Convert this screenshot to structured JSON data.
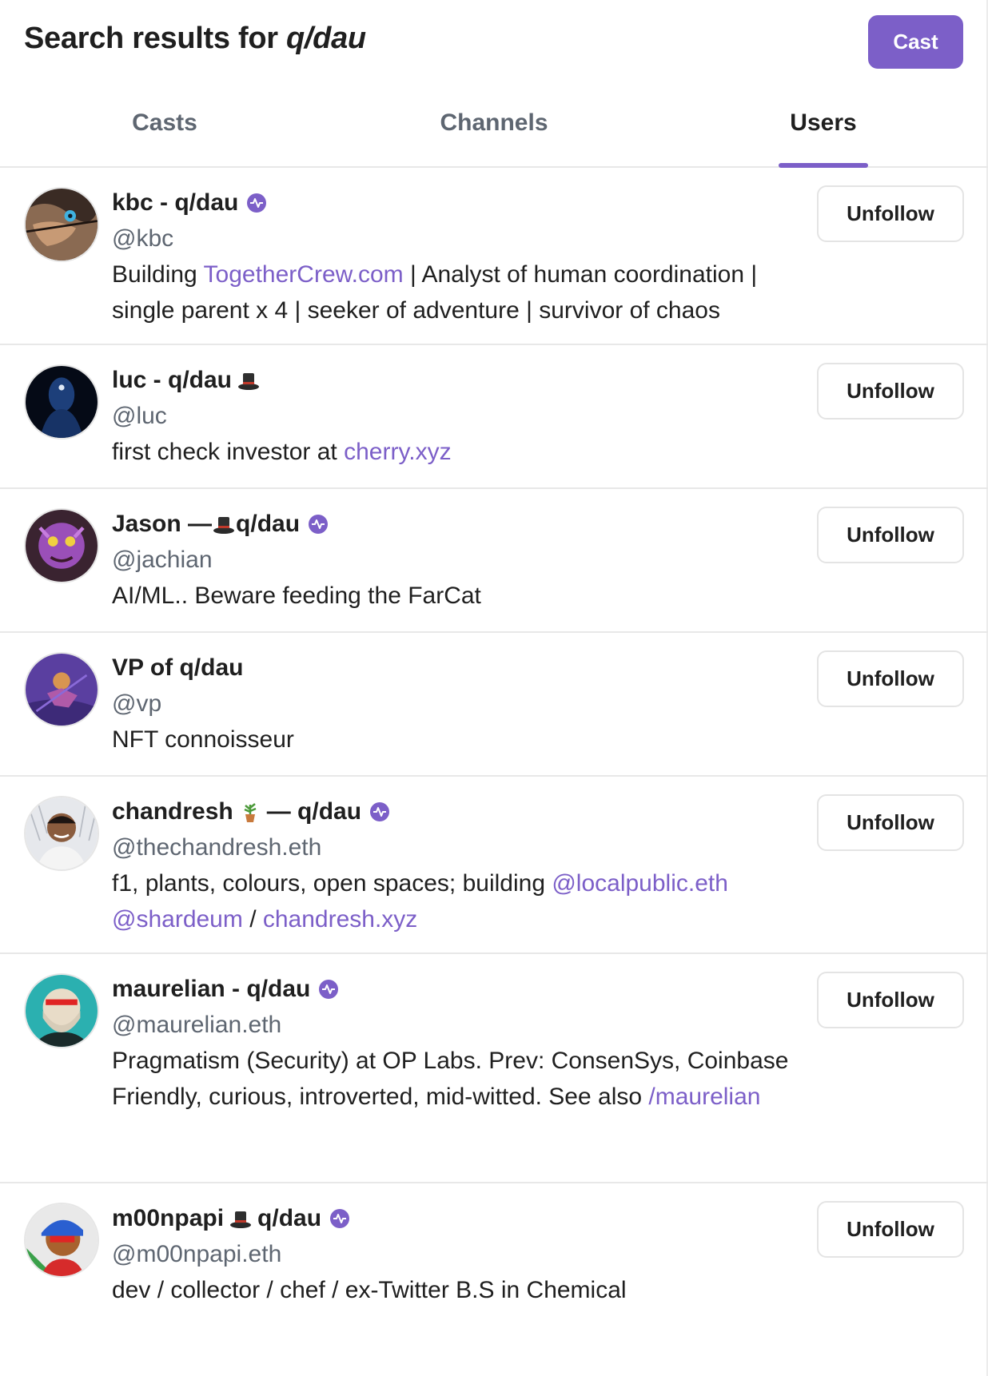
{
  "header": {
    "title_prefix": "Search results for",
    "query": "q/dau",
    "cast_label": "Cast"
  },
  "tabs": [
    {
      "label": "Casts",
      "active": false
    },
    {
      "label": "Channels",
      "active": false
    },
    {
      "label": "Users",
      "active": true
    }
  ],
  "colors": {
    "accent": "#7c5fc8",
    "muted_text": "#5e6671",
    "border": "#e8e8e8"
  },
  "users": [
    {
      "name": "kbc - q/dau",
      "badge": "verified-icon",
      "handle": "@kbc",
      "bio": [
        {
          "text": "Building "
        },
        {
          "text": "TogetherCrew.com",
          "link": true
        },
        {
          "text": " | Analyst of human coordination | single parent x 4 | seeker of adventure | survivor of chaos"
        }
      ],
      "button": "Unfollow"
    },
    {
      "name": "luc - q/dau",
      "badge": "top-hat-icon",
      "handle": "@luc",
      "bio": [
        {
          "text": "first check investor at "
        },
        {
          "text": "cherry.xyz",
          "link": true
        }
      ],
      "button": "Unfollow"
    },
    {
      "name_parts": [
        "Jason — ",
        "q/dau"
      ],
      "badge": "verified-icon",
      "handle": "@jachian",
      "bio": [
        {
          "text": "AI/ML.. Beware feeding the FarCat"
        }
      ],
      "button": "Unfollow"
    },
    {
      "name": "VP of q/dau",
      "handle": "@vp",
      "bio": [
        {
          "text": "NFT connoisseur"
        }
      ],
      "button": "Unfollow"
    },
    {
      "name_parts": [
        "chandresh",
        "— q/dau"
      ],
      "badge": "verified-icon",
      "handle": "@thechandresh.eth",
      "bio": [
        {
          "text": "f1, plants, colours, open spaces; building "
        },
        {
          "text": "@localpublic.eth",
          "link": true
        },
        {
          "text": " "
        },
        {
          "text": "@shardeum",
          "link": true
        },
        {
          "text": " / "
        },
        {
          "text": "chandresh.xyz",
          "link": true
        }
      ],
      "button": "Unfollow"
    },
    {
      "name": "maurelian - q/dau",
      "badge": "verified-icon",
      "handle": "@maurelian.eth",
      "bio": [
        {
          "text": "Pragmatism (Security) at OP Labs. Prev: ConsenSys, Coinbase Friendly, curious, introverted, mid-witted. See also "
        },
        {
          "text": "/maurelian",
          "link": true
        }
      ],
      "button": "Unfollow"
    },
    {
      "name_parts": [
        "m00npapi",
        "q/dau"
      ],
      "badge": "verified-icon",
      "handle": "@m00npapi.eth",
      "bio": [
        {
          "text": "dev / collector / chef / ex-Twitter B.S in Chemical"
        }
      ],
      "button": "Unfollow"
    }
  ]
}
